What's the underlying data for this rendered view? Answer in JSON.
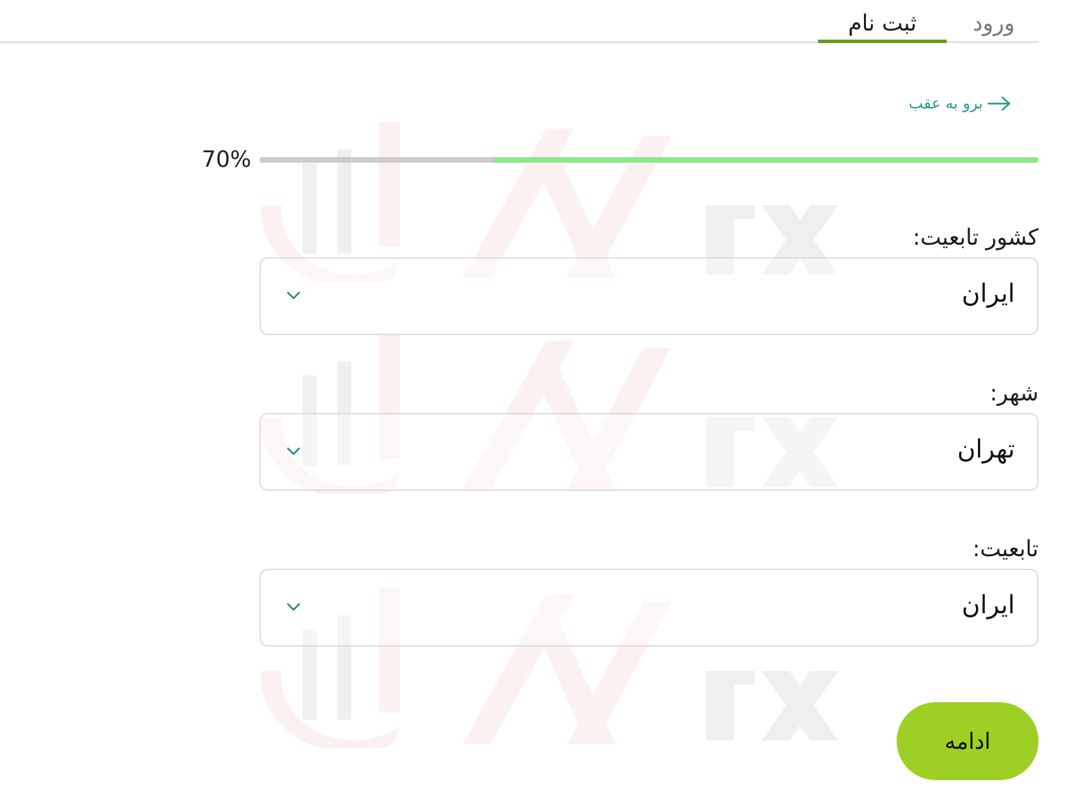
{
  "tabs": {
    "login": "ورود",
    "register": "ثبت نام",
    "active": "register"
  },
  "back_link": {
    "label": "برو به عقب",
    "icon": "arrow-right-icon"
  },
  "progress": {
    "percent_label": "70%",
    "value": 0.7
  },
  "fields": [
    {
      "label": "کشور تابعیت:",
      "value": "ایران",
      "icon": "chevron-down-icon"
    },
    {
      "label": "شهر:",
      "value": "تهران",
      "icon": "chevron-down-icon"
    },
    {
      "label": "تابعیت:",
      "value": "ایران",
      "icon": "chevron-down-icon"
    }
  ],
  "continue_button": {
    "label": "ادامه"
  },
  "colors": {
    "accent_green": "#9ecf25",
    "progress_fill": "#8ce88a",
    "tab_underline": "#6a9a1a",
    "link_teal": "#2a9a8e",
    "chevron_teal": "#2a8a80"
  }
}
